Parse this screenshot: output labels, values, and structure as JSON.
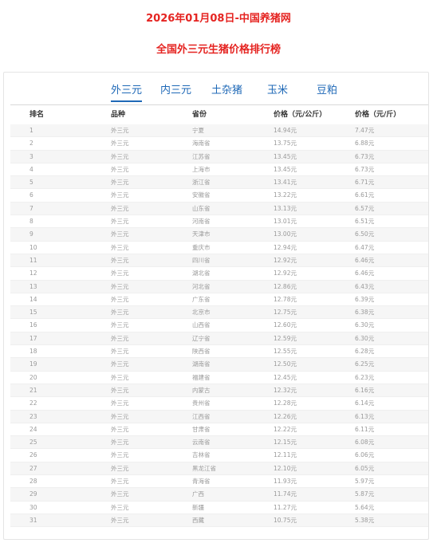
{
  "page": {
    "title": "2026年01月08日-中国养猪网",
    "subtitle": "全国外三元生猪价格排行榜",
    "accent_color": "#e52421",
    "link_color": "#1f69b7"
  },
  "tabs": [
    {
      "label": "外三元",
      "active": true
    },
    {
      "label": "内三元",
      "active": false
    },
    {
      "label": "土杂猪",
      "active": false
    },
    {
      "label": "玉米",
      "active": false
    },
    {
      "label": "豆粕",
      "active": false
    }
  ],
  "table": {
    "headers": [
      "排名",
      "品种",
      "省份",
      "价格（元/公斤）",
      "价格（元/斤）"
    ],
    "rows": [
      [
        "1",
        "外三元",
        "宁夏",
        "14.94元",
        "7.47元"
      ],
      [
        "2",
        "外三元",
        "海南省",
        "13.75元",
        "6.88元"
      ],
      [
        "3",
        "外三元",
        "江苏省",
        "13.45元",
        "6.73元"
      ],
      [
        "4",
        "外三元",
        "上海市",
        "13.45元",
        "6.73元"
      ],
      [
        "5",
        "外三元",
        "浙江省",
        "13.41元",
        "6.71元"
      ],
      [
        "6",
        "外三元",
        "安徽省",
        "13.22元",
        "6.61元"
      ],
      [
        "7",
        "外三元",
        "山东省",
        "13.13元",
        "6.57元"
      ],
      [
        "8",
        "外三元",
        "河南省",
        "13.01元",
        "6.51元"
      ],
      [
        "9",
        "外三元",
        "天津市",
        "13.00元",
        "6.50元"
      ],
      [
        "10",
        "外三元",
        "重庆市",
        "12.94元",
        "6.47元"
      ],
      [
        "11",
        "外三元",
        "四川省",
        "12.92元",
        "6.46元"
      ],
      [
        "12",
        "外三元",
        "湖北省",
        "12.92元",
        "6.46元"
      ],
      [
        "13",
        "外三元",
        "河北省",
        "12.86元",
        "6.43元"
      ],
      [
        "14",
        "外三元",
        "广东省",
        "12.78元",
        "6.39元"
      ],
      [
        "15",
        "外三元",
        "北京市",
        "12.75元",
        "6.38元"
      ],
      [
        "16",
        "外三元",
        "山西省",
        "12.60元",
        "6.30元"
      ],
      [
        "17",
        "外三元",
        "辽宁省",
        "12.59元",
        "6.30元"
      ],
      [
        "18",
        "外三元",
        "陕西省",
        "12.55元",
        "6.28元"
      ],
      [
        "19",
        "外三元",
        "湖南省",
        "12.50元",
        "6.25元"
      ],
      [
        "20",
        "外三元",
        "福建省",
        "12.45元",
        "6.23元"
      ],
      [
        "21",
        "外三元",
        "内蒙古",
        "12.32元",
        "6.16元"
      ],
      [
        "22",
        "外三元",
        "贵州省",
        "12.28元",
        "6.14元"
      ],
      [
        "23",
        "外三元",
        "江西省",
        "12.26元",
        "6.13元"
      ],
      [
        "24",
        "外三元",
        "甘肃省",
        "12.22元",
        "6.11元"
      ],
      [
        "25",
        "外三元",
        "云南省",
        "12.15元",
        "6.08元"
      ],
      [
        "26",
        "外三元",
        "吉林省",
        "12.11元",
        "6.06元"
      ],
      [
        "27",
        "外三元",
        "黑龙江省",
        "12.10元",
        "6.05元"
      ],
      [
        "28",
        "外三元",
        "青海省",
        "11.93元",
        "5.97元"
      ],
      [
        "29",
        "外三元",
        "广西",
        "11.74元",
        "5.87元"
      ],
      [
        "30",
        "外三元",
        "新疆",
        "11.27元",
        "5.64元"
      ],
      [
        "31",
        "外三元",
        "西藏",
        "10.75元",
        "5.38元"
      ]
    ]
  }
}
